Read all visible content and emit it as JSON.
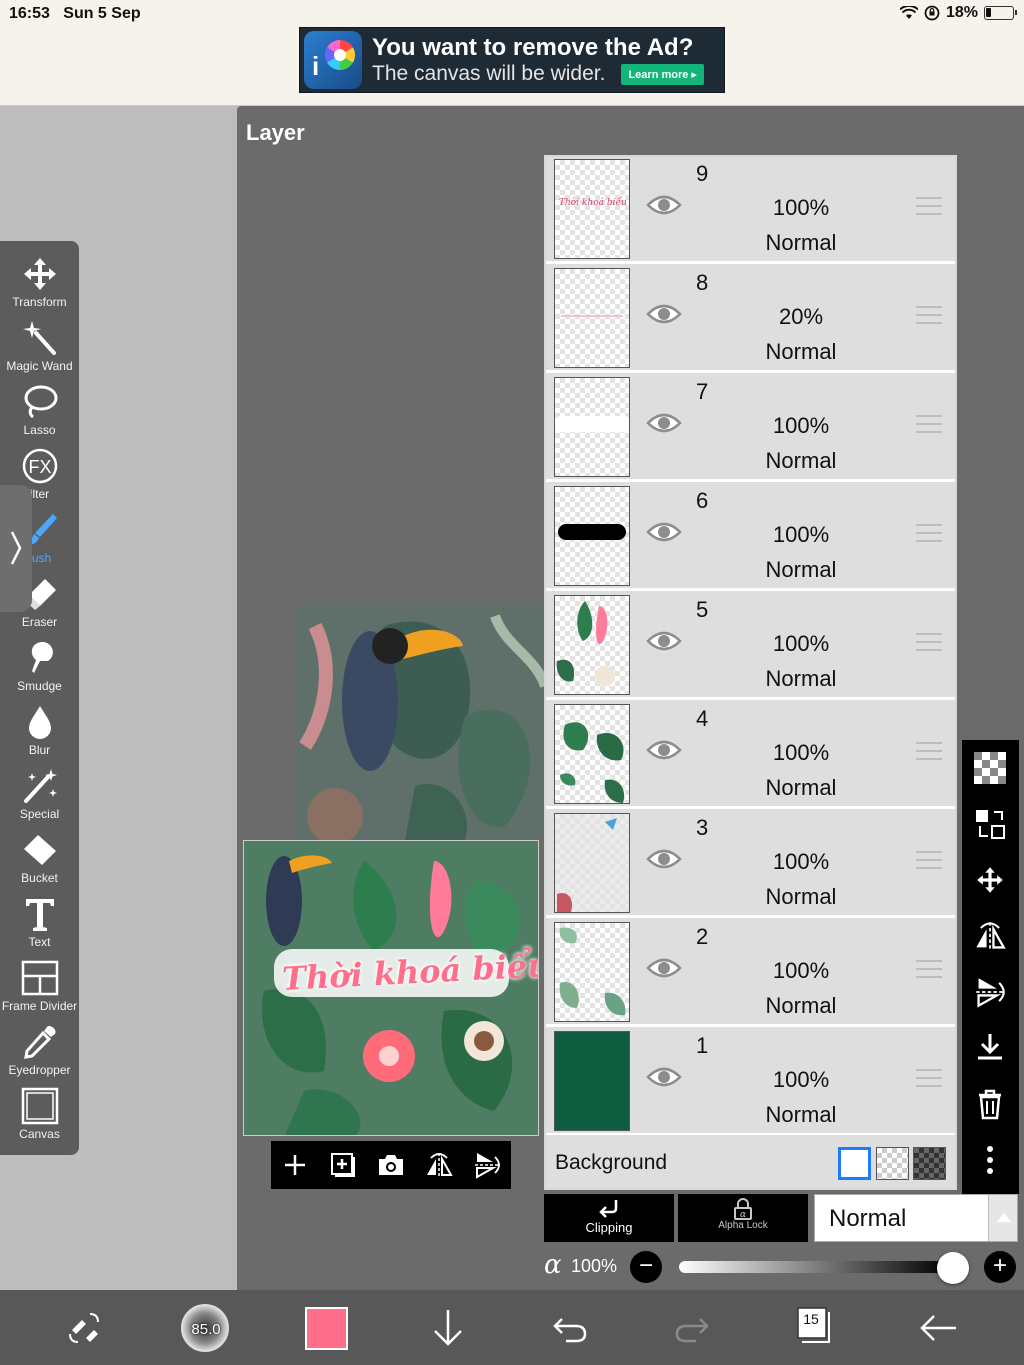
{
  "status_bar": {
    "time": "16:53",
    "date": "Sun 5 Sep",
    "battery": "18%"
  },
  "ad": {
    "title": "You want to remove the Ad?",
    "subtitle": "The canvas will be wider.",
    "cta": "Learn more"
  },
  "toolbar": {
    "tools": [
      {
        "label": "Transform",
        "icon": "move-icon"
      },
      {
        "label": "Magic Wand",
        "icon": "magic-wand-icon"
      },
      {
        "label": "Lasso",
        "icon": "lasso-icon"
      },
      {
        "label": "ilter",
        "icon": "fx-icon"
      },
      {
        "label": "rush",
        "icon": "brush-icon"
      },
      {
        "label": "Eraser",
        "icon": "eraser-icon"
      },
      {
        "label": "Smudge",
        "icon": "smudge-icon"
      },
      {
        "label": "Blur",
        "icon": "blur-drop-icon"
      },
      {
        "label": "Special",
        "icon": "special-icon"
      },
      {
        "label": "Bucket",
        "icon": "bucket-icon"
      },
      {
        "label": "Text",
        "icon": "text-icon"
      },
      {
        "label": "Frame Divider",
        "icon": "frame-divider-icon"
      },
      {
        "label": "Eyedropper",
        "icon": "eyedropper-icon"
      },
      {
        "label": "Canvas",
        "icon": "canvas-icon"
      }
    ],
    "active_tool": "rush",
    "fx_label": "FX"
  },
  "layer_panel": {
    "title": "Layer",
    "preview_caption": "Thời khoá biểu",
    "layers": [
      {
        "number": "9",
        "opacity": "100%",
        "blend": "Normal",
        "visible": true
      },
      {
        "number": "8",
        "opacity": "20%",
        "blend": "Normal",
        "visible": true
      },
      {
        "number": "7",
        "opacity": "100%",
        "blend": "Normal",
        "visible": true
      },
      {
        "number": "6",
        "opacity": "100%",
        "blend": "Normal",
        "visible": true
      },
      {
        "number": "5",
        "opacity": "100%",
        "blend": "Normal",
        "visible": true
      },
      {
        "number": "4",
        "opacity": "100%",
        "blend": "Normal",
        "visible": true
      },
      {
        "number": "3",
        "opacity": "100%",
        "blend": "Normal",
        "visible": true
      },
      {
        "number": "2",
        "opacity": "100%",
        "blend": "Normal",
        "visible": true
      },
      {
        "number": "1",
        "opacity": "100%",
        "blend": "Normal",
        "visible": true
      }
    ],
    "layer9_thumb_text": "Thời khoá biểu",
    "background": {
      "label": "Background",
      "selected": "white"
    },
    "clipping_label": "Clipping",
    "alpha_lock_label": "Alpha Lock",
    "blend_mode": "Normal",
    "opacity_symbol": "α",
    "opacity": "100%",
    "opacity_value": 1.0,
    "minus": "−",
    "plus": "+"
  },
  "bottom_bar": {
    "brush_size": "85.0",
    "color": "#ff6f8c",
    "layer_count": "15"
  }
}
